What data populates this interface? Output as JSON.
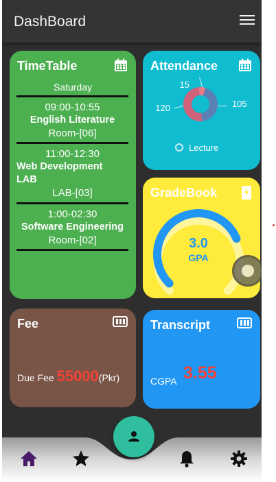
{
  "app_bar": {
    "title": "DashBoard",
    "menu_icon": "hamburger-menu-icon"
  },
  "timetable": {
    "title": "TimeTable",
    "icon": "calendar-icon",
    "day": "Saturday",
    "slots": [
      {
        "time": "09:00-10:55",
        "subject": "English Literature",
        "room": "Room-[06]"
      },
      {
        "time": "11:00-12:30",
        "subject_line1": "Web Development",
        "subject_line2": "LAB",
        "room": "LAB-[03]"
      },
      {
        "time": "1:00-02:30",
        "subject": "Software Engineering",
        "room": "Room-[02]"
      }
    ]
  },
  "attendance": {
    "title": "Attendance",
    "icon": "calendar-icon",
    "legend_label": "Lecture",
    "colors": {
      "card": "#10bcd0",
      "large": "#5c7fb4",
      "medium": "#cf6278",
      "small": "#e77b86"
    }
  },
  "gradebook": {
    "title": "GradeBook",
    "icon": "phone-icon",
    "value": "3.0",
    "label": "GPA",
    "progress": 0.75
  },
  "fee": {
    "title": "Fee",
    "icon": "ticket-icon",
    "label": "Due Fee",
    "amount": "55000",
    "unit": "(Pkr)"
  },
  "transcript": {
    "title": "Transcript",
    "icon": "ticket-icon",
    "label": "CGPA",
    "value": "3.55"
  },
  "bottom_nav": {
    "items": [
      {
        "name": "home",
        "icon": "home-icon",
        "active": true
      },
      {
        "name": "favorites",
        "icon": "star-icon",
        "active": false
      },
      {
        "name": "notifications",
        "icon": "bell-icon",
        "active": false
      },
      {
        "name": "settings",
        "icon": "gear-icon",
        "active": false
      }
    ],
    "fab_icon": "person-icon",
    "colors": {
      "active": "#4a1a6b",
      "inactive": "#111111",
      "fab": "#2fbf9e"
    }
  },
  "chart_data": {
    "type": "pie",
    "categories": [
      "",
      "",
      ""
    ],
    "values": [
      105,
      120,
      15
    ],
    "title": "",
    "data_labels": [
      "105",
      "120",
      "15"
    ],
    "legend": [
      "Lecture"
    ]
  }
}
